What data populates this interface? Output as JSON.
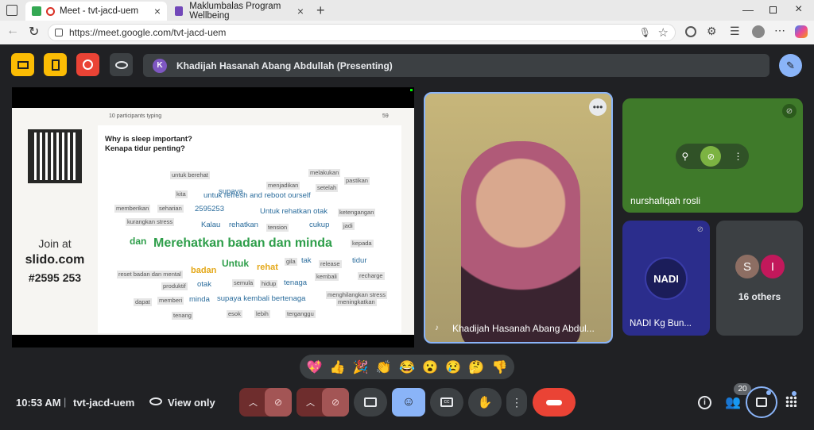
{
  "browser": {
    "tabs": [
      {
        "title": "Meet - tvt-jacd-uem"
      },
      {
        "title": "Maklumbalas Program Wellbeing"
      }
    ],
    "url": "https://meet.google.com/tvt-jacd-uem"
  },
  "meet": {
    "presenter_avatar": "K",
    "presenting_text": "Khadijah Hasanah Abang Abdullah (Presenting)",
    "slide": {
      "typing": "10 participants typing",
      "count": "59",
      "join": "Join at",
      "site": "slido.com",
      "code": "#2595 253",
      "question1": "Why is sleep important?",
      "question2": "Kenapa tidur penting?",
      "words": [
        {
          "t": "untuk berehat",
          "c": "s"
        },
        {
          "t": "menjadikan",
          "c": "s"
        },
        {
          "t": "melakukan",
          "c": "s"
        },
        {
          "t": "pastikan",
          "c": "s"
        },
        {
          "t": "setelah",
          "c": "s"
        },
        {
          "t": "kita",
          "c": "s"
        },
        {
          "t": "supaya",
          "c": "m"
        },
        {
          "t": "untuk refresh and reboot ourself",
          "c": "m"
        },
        {
          "t": "memberikan",
          "c": "s"
        },
        {
          "t": "seharian",
          "c": "s"
        },
        {
          "t": "2595253",
          "c": "m"
        },
        {
          "t": "Untuk rehatkan otak",
          "c": "m"
        },
        {
          "t": "ketengangan",
          "c": "s"
        },
        {
          "t": "kurangkan stress",
          "c": "s"
        },
        {
          "t": "Kalau",
          "c": "m"
        },
        {
          "t": "rehatkan",
          "c": "m"
        },
        {
          "t": "tension",
          "c": "s"
        },
        {
          "t": "cukup",
          "c": "m"
        },
        {
          "t": "jadi",
          "c": "s"
        },
        {
          "t": "dan",
          "c": "g"
        },
        {
          "t": "Merehatkan badan dan minda",
          "c": "l"
        },
        {
          "t": "kepada",
          "c": "s"
        },
        {
          "t": "gila",
          "c": "s"
        },
        {
          "t": "tak",
          "c": "m"
        },
        {
          "t": "release",
          "c": "s"
        },
        {
          "t": "tidur",
          "c": "m"
        },
        {
          "t": "reset badan dan mental",
          "c": "s"
        },
        {
          "t": "badan",
          "c": "y"
        },
        {
          "t": "Untuk",
          "c": "g"
        },
        {
          "t": "rehat",
          "c": "y"
        },
        {
          "t": "kembali",
          "c": "s"
        },
        {
          "t": "recharge",
          "c": "s"
        },
        {
          "t": "produktif",
          "c": "s"
        },
        {
          "t": "otak",
          "c": "m"
        },
        {
          "t": "semula",
          "c": "s"
        },
        {
          "t": "hidup",
          "c": "s"
        },
        {
          "t": "tenaga",
          "c": "m"
        },
        {
          "t": "menghilangkan stress",
          "c": "s"
        },
        {
          "t": "dapat",
          "c": "s"
        },
        {
          "t": "memberi",
          "c": "s"
        },
        {
          "t": "minda",
          "c": "m"
        },
        {
          "t": "supaya kembali bertenaga",
          "c": "m"
        },
        {
          "t": "meningkatkan",
          "c": "s"
        },
        {
          "t": "tenang",
          "c": "s"
        },
        {
          "t": "esok",
          "c": "s"
        },
        {
          "t": "lebih",
          "c": "s"
        },
        {
          "t": "terganggu",
          "c": "s"
        }
      ]
    },
    "participants": {
      "presenter_name": "Khadijah Hasanah Abang Abdul...",
      "tile2_name": "nurshafiqah rosli",
      "tile3_logo": "NADI",
      "tile3_name": "NADI Kg Bun...",
      "others_initials": [
        "S",
        "I"
      ],
      "others_text": "16 others"
    },
    "reactions": [
      "💖",
      "👍",
      "🎉",
      "👏",
      "😂",
      "😮",
      "😢",
      "🤔",
      "👎"
    ],
    "bottom": {
      "time": "10:53 AM",
      "sep": "|",
      "code": "tvt-jacd-uem",
      "view": "View only",
      "people_badge": "20"
    }
  },
  "colors": {
    "accent": "#8ab4f8",
    "yellow": "#fbbc04",
    "red": "#ea4335",
    "green_tile": "#3f7a2a",
    "nadi_tile": "#2b2d8c"
  }
}
